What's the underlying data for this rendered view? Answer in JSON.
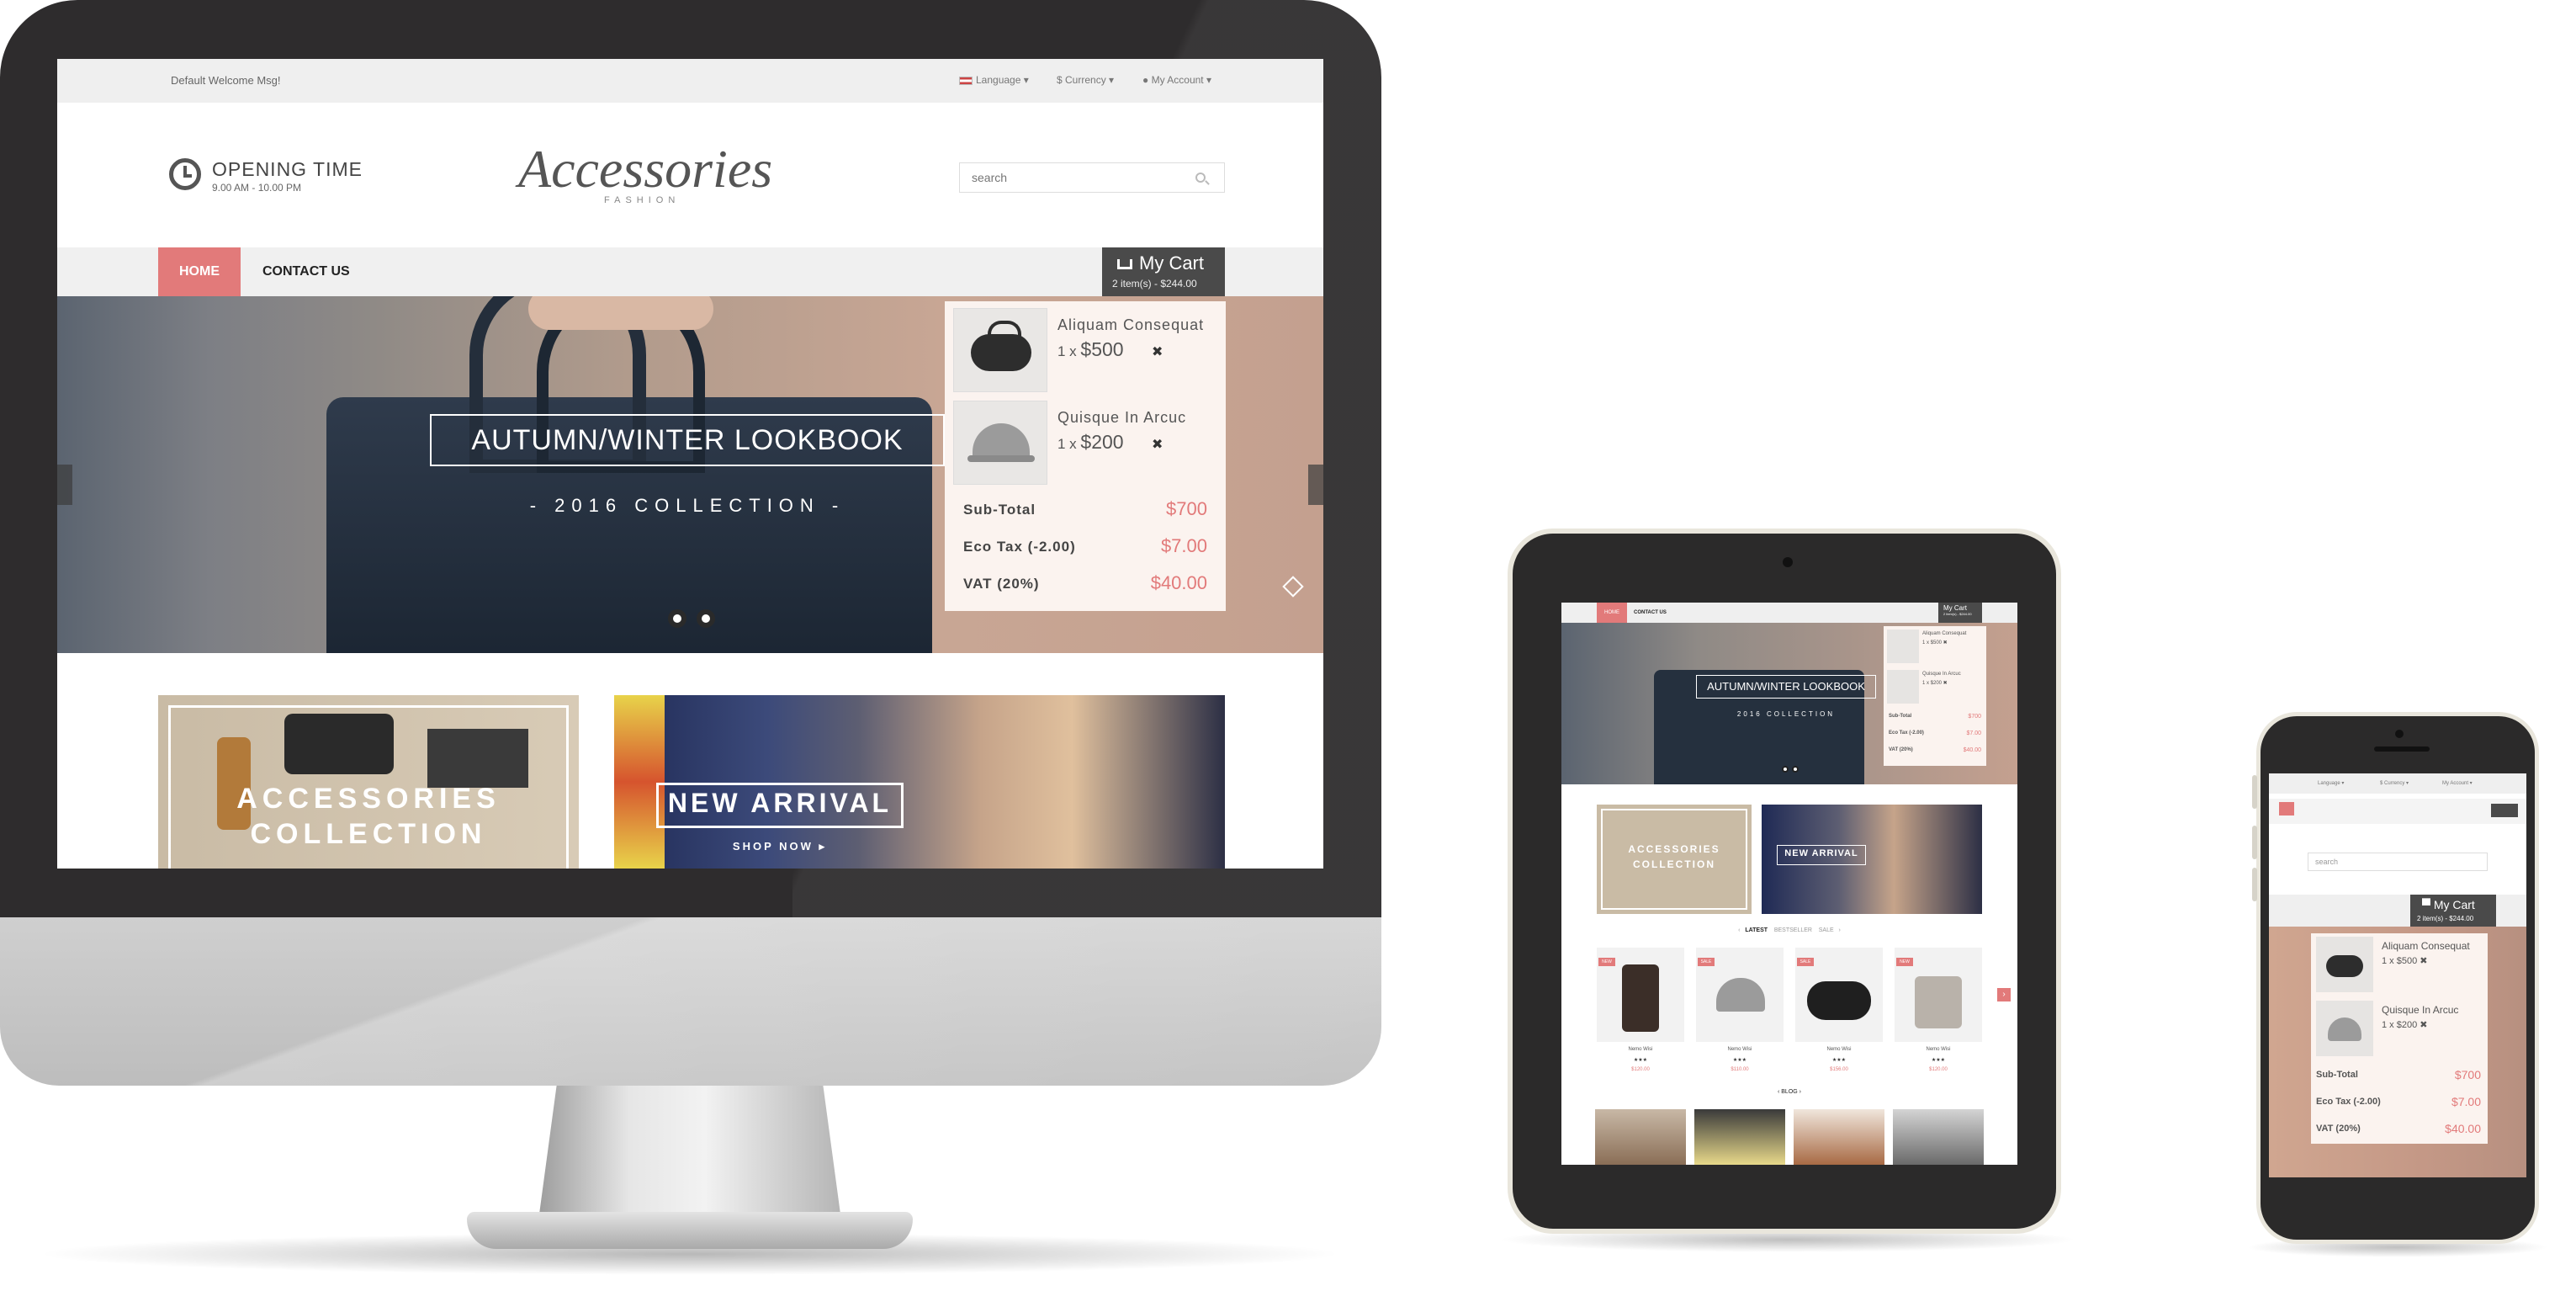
{
  "desktop": {
    "topbar": {
      "welcome": "Default Welcome Msg!",
      "language": "Language",
      "currency": "$ Currency",
      "account": "My Account"
    },
    "header": {
      "opening_title": "OPENING TIME",
      "opening_hours": "9.00 AM - 10.00 PM",
      "logo_main": "Accessories",
      "logo_sub": "FASHION",
      "search_placeholder": "search"
    },
    "nav": {
      "home": "HOME",
      "contact": "CONTACT US"
    },
    "cart": {
      "title": "My Cart",
      "summary": "2 item(s) - $244.00",
      "items": [
        {
          "name": "Aliquam Consequat",
          "qty": "1 x",
          "price": "$500",
          "remove": "✖"
        },
        {
          "name": "Quisque In Arcuc",
          "qty": "1 x",
          "price": "$200",
          "remove": "✖"
        }
      ],
      "subtotal_label": "Sub-Total",
      "subtotal_value": "$700",
      "ecotax_label": "Eco Tax (-2.00)",
      "ecotax_value": "$7.00",
      "vat_label": "VAT (20%)",
      "vat_value": "$40.00"
    },
    "hero": {
      "title": "AUTUMN/WINTER LOOKBOOK",
      "subtitle": "- 2016 COLLECTION -"
    },
    "promos": {
      "left_line1": "ACCESSORIES",
      "left_line2": "COLLECTION",
      "right_title": "NEW ARRIVAL",
      "right_link": "SHOP NOW ▸"
    }
  },
  "tablet": {
    "nav_home": "HOME",
    "nav_contact": "CONTACT US",
    "cart_title": "My Cart",
    "cart_summary": "2 item(s) - $244.00",
    "hero_title": "AUTUMN/WINTER LOOKBOOK",
    "hero_subtitle": "2016 COLLECTION",
    "cart_items": [
      {
        "name": "Aliquam Consequat",
        "line": "1 x $500 ✖"
      },
      {
        "name": "Quisque In Arcuc",
        "line": "1 x $200 ✖"
      }
    ],
    "cart_subtotal_label": "Sub-Total",
    "cart_subtotal_value": "$700",
    "cart_ecotax_label": "Eco Tax (-2.00)",
    "cart_ecotax_value": "$7.00",
    "cart_vat_label": "VAT (20%)",
    "cart_vat_value": "$40.00",
    "promo_left_line1": "ACCESSORIES",
    "promo_left_line2": "COLLECTION",
    "promo_right": "NEW ARRIVAL",
    "tabs": {
      "latest": "LATEST",
      "bestseller": "BESTSELLER",
      "sale": "SALE"
    },
    "products": [
      {
        "name": "Nemo Wisi",
        "stars": "★★★",
        "price": "$120.00",
        "badge": "NEW"
      },
      {
        "name": "Nemo Wisi",
        "stars": "★★★",
        "price": "$110.00",
        "badge": "SALE"
      },
      {
        "name": "Nemo Wisi",
        "stars": "★★★",
        "price": "$156.00",
        "badge": "SALE"
      },
      {
        "name": "Nemo Wisi",
        "stars": "★★★",
        "price": "$120.00",
        "badge": "NEW"
      }
    ],
    "blog_label": "BLOG"
  },
  "phone": {
    "language": "Language",
    "currency": "$ Currency",
    "account": "My Account",
    "search_placeholder": "search",
    "cart_title": "My Cart",
    "cart_summary": "2 item(s) - $244.00",
    "cart_items": [
      {
        "name": "Aliquam Consequat",
        "line": "1 x $500   ✖"
      },
      {
        "name": "Quisque In Arcuc",
        "line": "1 x $200   ✖"
      }
    ],
    "subtotal_label": "Sub-Total",
    "subtotal_value": "$700",
    "ecotax_label": "Eco Tax (-2.00)",
    "ecotax_value": "$7.00",
    "vat_label": "VAT (20%)",
    "vat_value": "$40.00"
  },
  "colors": {
    "accent": "#e27a7a",
    "cart_dark": "#4a4a4a",
    "bezel": "#2e2c2d"
  }
}
